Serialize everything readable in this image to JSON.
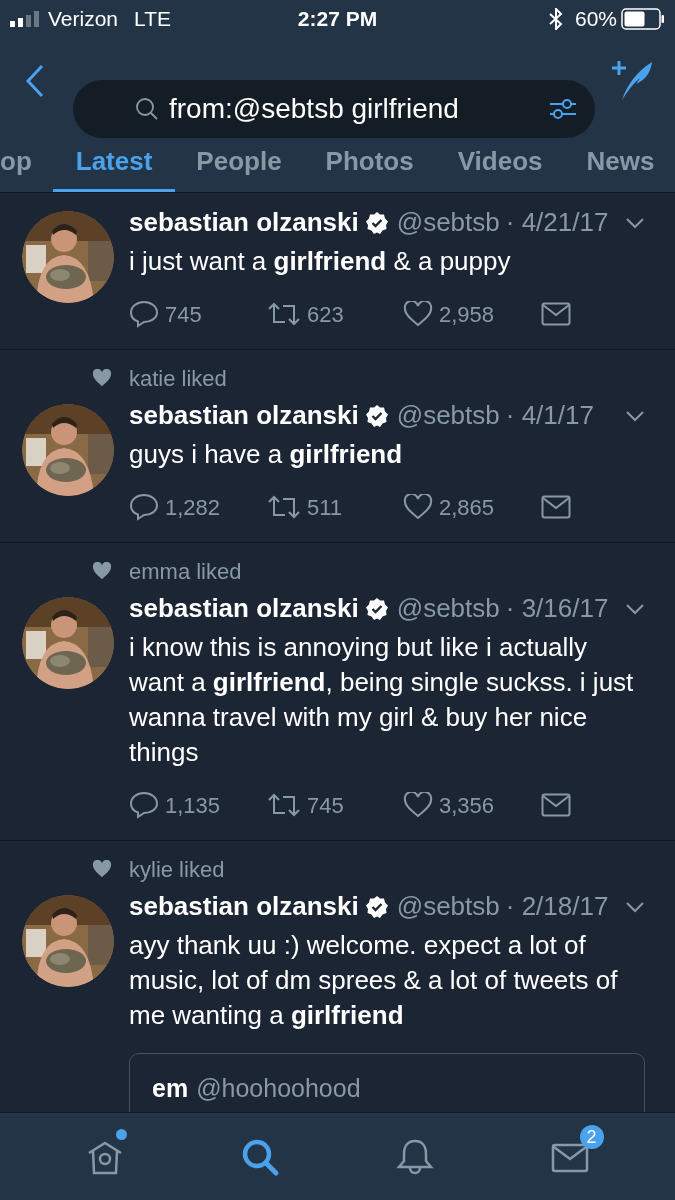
{
  "status_bar": {
    "carrier": "Verizon",
    "network": "LTE",
    "time": "2:27 PM",
    "battery": "60%"
  },
  "search": {
    "value": "from:@sebtsb girlfriend"
  },
  "tabs": [
    {
      "label": "op",
      "selected": false
    },
    {
      "label": "Latest",
      "selected": true
    },
    {
      "label": "People",
      "selected": false
    },
    {
      "label": "Photos",
      "selected": false
    },
    {
      "label": "Videos",
      "selected": false
    },
    {
      "label": "News",
      "selected": false
    }
  ],
  "tweets": [
    {
      "name": "sebastian olzanski",
      "verified": true,
      "handle": "@sebtsb",
      "date": "· 4/21/17",
      "text": "i just want a **girlfriend** & a puppy",
      "replies": "745",
      "retweets": "623",
      "likes": "2,958"
    },
    {
      "liked_by": "katie liked",
      "name": "sebastian olzanski",
      "verified": true,
      "handle": "@sebtsb",
      "date": "· 4/1/17",
      "text": "guys i have a **girlfriend**",
      "replies": "1,282",
      "retweets": "511",
      "likes": "2,865"
    },
    {
      "liked_by": "emma liked",
      "name": "sebastian olzanski",
      "verified": true,
      "handle": "@sebtsb",
      "date": "· 3/16/17",
      "text": "i know this is annoying but like i actually want a **girlfriend**, being single suckss. i just wanna travel with my girl & buy her nice things",
      "replies": "1,135",
      "retweets": "745",
      "likes": "3,356"
    },
    {
      "liked_by": "kylie liked",
      "name": "sebastian olzanski",
      "verified": true,
      "handle": "@sebtsb",
      "date": "· 2/18/17",
      "text": "ayy thank uu :) welcome. expect a lot of music, lot of dm sprees & a lot of tweets of me wanting a **girlfriend**",
      "quote": {
        "name": "em",
        "handle": "@hoohoohood"
      }
    }
  ],
  "bottom_nav": [
    {
      "kind": "home",
      "selected": false,
      "dot": true
    },
    {
      "kind": "search",
      "selected": true,
      "dot": false
    },
    {
      "kind": "notifications",
      "selected": false,
      "dot": false
    },
    {
      "kind": "messages",
      "selected": false,
      "dot": false,
      "badge": "2"
    }
  ]
}
